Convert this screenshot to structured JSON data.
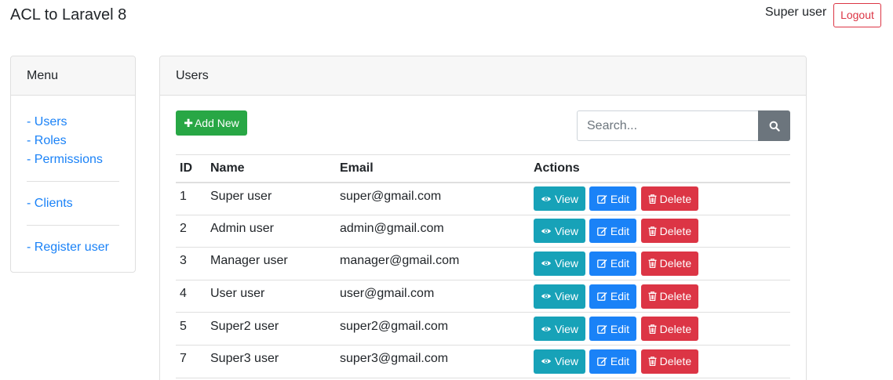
{
  "app": {
    "title": "ACL to Laravel 8"
  },
  "user_nav": {
    "username": "Super user",
    "logout_label": "Logout"
  },
  "menu": {
    "title": "Menu",
    "items": [
      {
        "label": "- Users"
      },
      {
        "label": "- Roles"
      },
      {
        "label": "- Permissions"
      },
      {
        "label": "- Clients"
      },
      {
        "label": "- Register user"
      }
    ]
  },
  "users_panel": {
    "title": "Users",
    "add_label": "Add New",
    "search_placeholder": "Search...",
    "columns": [
      "ID",
      "Name",
      "Email",
      "Actions"
    ],
    "action_labels": {
      "view": "View",
      "edit": "Edit",
      "delete": "Delete"
    },
    "rows": [
      {
        "id": "1",
        "name": "Super user",
        "email": "super@gmail.com"
      },
      {
        "id": "2",
        "name": "Admin user",
        "email": "admin@gmail.com"
      },
      {
        "id": "3",
        "name": "Manager user",
        "email": "manager@gmail.com"
      },
      {
        "id": "4",
        "name": "User user",
        "email": "user@gmail.com"
      },
      {
        "id": "5",
        "name": "Super2 user",
        "email": "super2@gmail.com"
      },
      {
        "id": "7",
        "name": "Super3 user",
        "email": "super3@gmail.com"
      }
    ]
  },
  "icons": {
    "add": "plus-icon",
    "search": "search-icon",
    "view": "eye-icon",
    "edit": "edit-icon",
    "delete": "trash-icon"
  },
  "colors": {
    "primary": "#1a82f7",
    "success": "#28a745",
    "danger": "#dc3545",
    "info": "#17a2b8",
    "secondary": "#6c757d"
  }
}
